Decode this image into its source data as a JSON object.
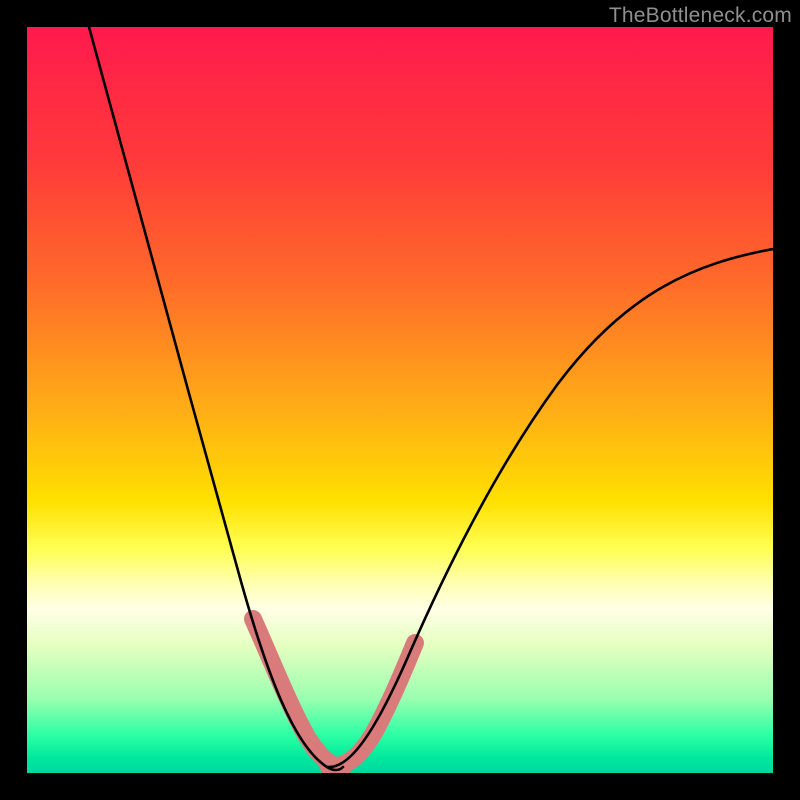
{
  "watermark": "TheBottleneck.com",
  "chart_data": {
    "type": "line",
    "title": "",
    "xlabel": "",
    "ylabel": "",
    "xlim": [
      0,
      100
    ],
    "ylim": [
      0,
      100
    ],
    "note": "No visible axes, ticks, or legend; values are estimated from curve geometry. Minimum (0) occurs around x≈38–42. Grey segments mark portions of each curve highlighted in the original.",
    "series": [
      {
        "name": "left-curve",
        "x": [
          8,
          12,
          16,
          20,
          24,
          28,
          32,
          34,
          36,
          38,
          40,
          42
        ],
        "values": [
          100,
          88,
          75,
          62,
          49,
          35,
          20,
          13,
          7,
          3,
          1,
          0
        ]
      },
      {
        "name": "right-curve",
        "x": [
          40,
          42,
          44,
          46,
          48,
          50,
          55,
          60,
          65,
          70,
          75,
          80,
          85,
          90,
          95,
          100
        ],
        "values": [
          0,
          1,
          4,
          8,
          12,
          16,
          24,
          32,
          39,
          45,
          51,
          56,
          60,
          64,
          67,
          70
        ]
      }
    ],
    "highlight_segments": [
      {
        "series": "left-curve",
        "x_range": [
          31,
          42
        ]
      },
      {
        "series": "right-curve",
        "x_range": [
          40,
          51
        ]
      }
    ],
    "colors": {
      "curve": "#000000",
      "highlight": "#d97b7b"
    }
  }
}
